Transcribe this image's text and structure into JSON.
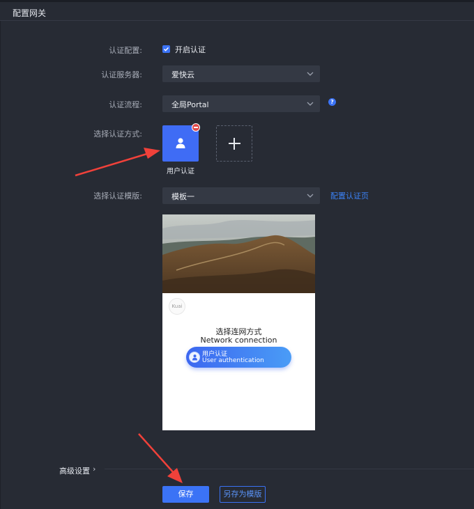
{
  "header": {
    "title": "配置网关"
  },
  "form": {
    "auth_config": {
      "label": "认证配置:",
      "checkbox_label": "开启认证",
      "checked": true
    },
    "auth_server": {
      "label": "认证服务器:",
      "value": "爱快云"
    },
    "auth_flow": {
      "label": "认证流程:",
      "value": "全局Portal",
      "help_icon": "question-circle-icon"
    },
    "auth_method": {
      "label": "选择认证方式:",
      "selected": "用户认证",
      "icon": "user-icon",
      "remove_icon": "minus-circle-icon",
      "add_icon": "plus-icon"
    },
    "auth_template": {
      "label": "选择认证模版:",
      "value": "模板一",
      "link": "配置认证页"
    }
  },
  "preview": {
    "logo_text": "Kuai",
    "title_cn": "选择连网方式",
    "title_en": "Network connection",
    "button_cn": "用户认证",
    "button_en": "User authentication"
  },
  "advanced": {
    "label": "高级设置",
    "chevron": "›"
  },
  "actions": {
    "save": "保存",
    "save_as_template": "另存为模版"
  },
  "colors": {
    "accent": "#3b73f6",
    "background": "#272b34",
    "annotation_arrow": "#f0413a"
  }
}
